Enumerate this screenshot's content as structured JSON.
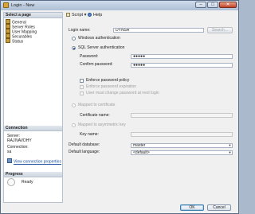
{
  "window": {
    "title": "Login - New"
  },
  "pages": {
    "header": "Select a page",
    "items": [
      "General",
      "Server Roles",
      "User Mapping",
      "Securables",
      "Status"
    ]
  },
  "connection": {
    "header": "Connection",
    "server_label": "Server:",
    "server_value": "RAJIVAVDHY",
    "connection_label": "Connection:",
    "connection_value": "sa",
    "link": "View connection properties"
  },
  "progress": {
    "header": "Progress",
    "status": "Ready"
  },
  "toolbar": {
    "script": "Script",
    "help": "Help"
  },
  "form": {
    "login_name_label": "Login name:",
    "login_name_value": "DYNSA",
    "search_button": "Search...",
    "windows_auth": "Windows authentication",
    "sql_auth": "SQL Server authentication",
    "password_label": "Password:",
    "password_value": "●●●●●",
    "confirm_label": "Confirm password:",
    "confirm_value": "●●●●●",
    "enforce_policy": "Enforce password policy",
    "enforce_expiration": "Enforce password expiration",
    "must_change": "User must change password at next login",
    "mapped_cert": "Mapped to certificate",
    "cert_name_label": "Certificate name:",
    "mapped_key": "Mapped to asymmetric key",
    "key_name_label": "Key name:",
    "default_db_label": "Default database:",
    "default_db_value": "master",
    "default_lang_label": "Default language:",
    "default_lang_value": "<default>"
  },
  "buttons": {
    "ok": "OK",
    "cancel": "Cancel"
  }
}
